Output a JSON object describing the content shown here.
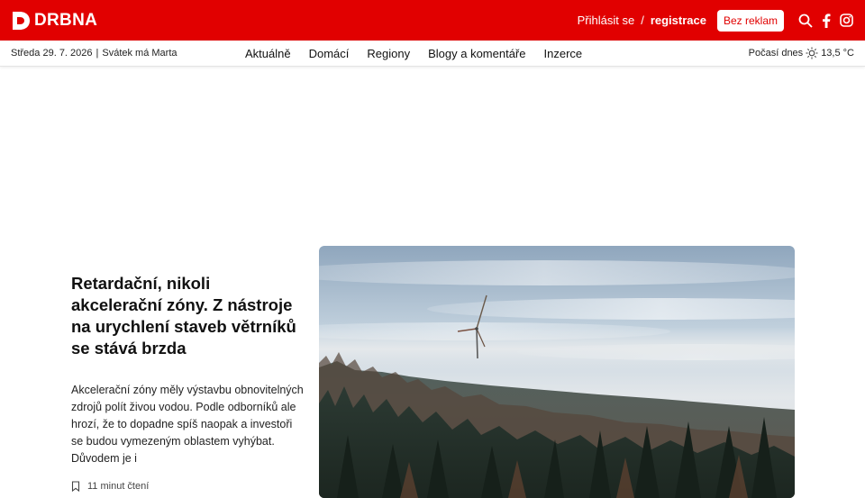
{
  "header": {
    "logo_text": "DRBNA",
    "login": "Přihlásit se",
    "separator": "/",
    "register": "registrace",
    "adfree": "Bez reklam",
    "icons": [
      "search-icon",
      "facebook-icon",
      "instagram-icon"
    ],
    "brand_color": "#e10000"
  },
  "subbar": {
    "date": "Středa 29. 7. 2026",
    "divider": "|",
    "nameday": "Svátek má Marta",
    "nav": [
      "Aktuálně",
      "Domácí",
      "Regiony",
      "Blogy a komentáře",
      "Inzerce"
    ],
    "weather_label": "Počasí dnes",
    "weather_icon": "sun-icon",
    "temperature": "13,5 °C"
  },
  "article": {
    "headline": "Retardační, nikoli akcelerační zóny. Z nástroje na urychlení staveb větrníků se stává brzda",
    "perex": "Akcelerační zóny měly výstavbu obnovitelných zdrojů polít živou vodou. Podle odborníků ale hrozí, že to dopadne spíš naopak a investoři se budou vymezeným oblastem vyhýbat. Důvodem je i",
    "reading_time": "11 minut čtení",
    "reading_icon": "bookmark-icon",
    "image": "wind-turbine-forest-photo"
  }
}
